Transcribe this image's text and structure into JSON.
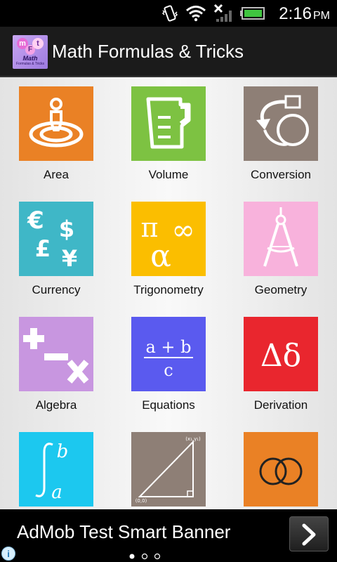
{
  "status_bar": {
    "time": "2:16",
    "ampm": "PM",
    "icons": [
      "vibrate-icon",
      "wifi-icon",
      "no-signal-icon",
      "battery-icon"
    ]
  },
  "app_bar": {
    "title": "Math Formulas & Tricks",
    "logo_letters": [
      "m",
      "F",
      "t"
    ],
    "logo_text": "Math",
    "logo_subtext": "Formulas & Tricks"
  },
  "grid": {
    "items": [
      {
        "label": "Area",
        "color": "#ea8125",
        "icon": "area-icon"
      },
      {
        "label": "Volume",
        "color": "#7dc242",
        "icon": "volume-beaker-icon"
      },
      {
        "label": "Conversion",
        "color": "#8e7f76",
        "icon": "conversion-icon"
      },
      {
        "label": "Currency",
        "color": "#3fb7c7",
        "icon": "currency-icon"
      },
      {
        "label": "Trigonometry",
        "color": "#fbbe00",
        "icon": "trigonometry-icon",
        "symbols": [
          "π",
          "∞",
          "α"
        ]
      },
      {
        "label": "Geometry",
        "color": "#f8b2dc",
        "icon": "compass-icon"
      },
      {
        "label": "Algebra",
        "color": "#c896e0",
        "icon": "algebra-icon"
      },
      {
        "label": "Equations",
        "color": "#5a5aef",
        "icon": "equations-icon",
        "symbols": [
          "a + b",
          "c"
        ]
      },
      {
        "label": "Derivation",
        "color": "#e9262e",
        "icon": "derivation-icon",
        "symbols": [
          "Δδ"
        ]
      },
      {
        "label": "",
        "color": "#1cc8ef",
        "icon": "integral-icon",
        "symbols": [
          "b",
          "a"
        ]
      },
      {
        "label": "",
        "color": "#8e7f76",
        "icon": "triangle-coordinates-icon",
        "symbols": [
          "(x₁,y₁)",
          "(0,0)"
        ]
      },
      {
        "label": "",
        "color": "#ea8125",
        "icon": "venn-diagram-icon"
      }
    ]
  },
  "ad_banner": {
    "text": "AdMob Test Smart Banner",
    "info_label": "i"
  }
}
